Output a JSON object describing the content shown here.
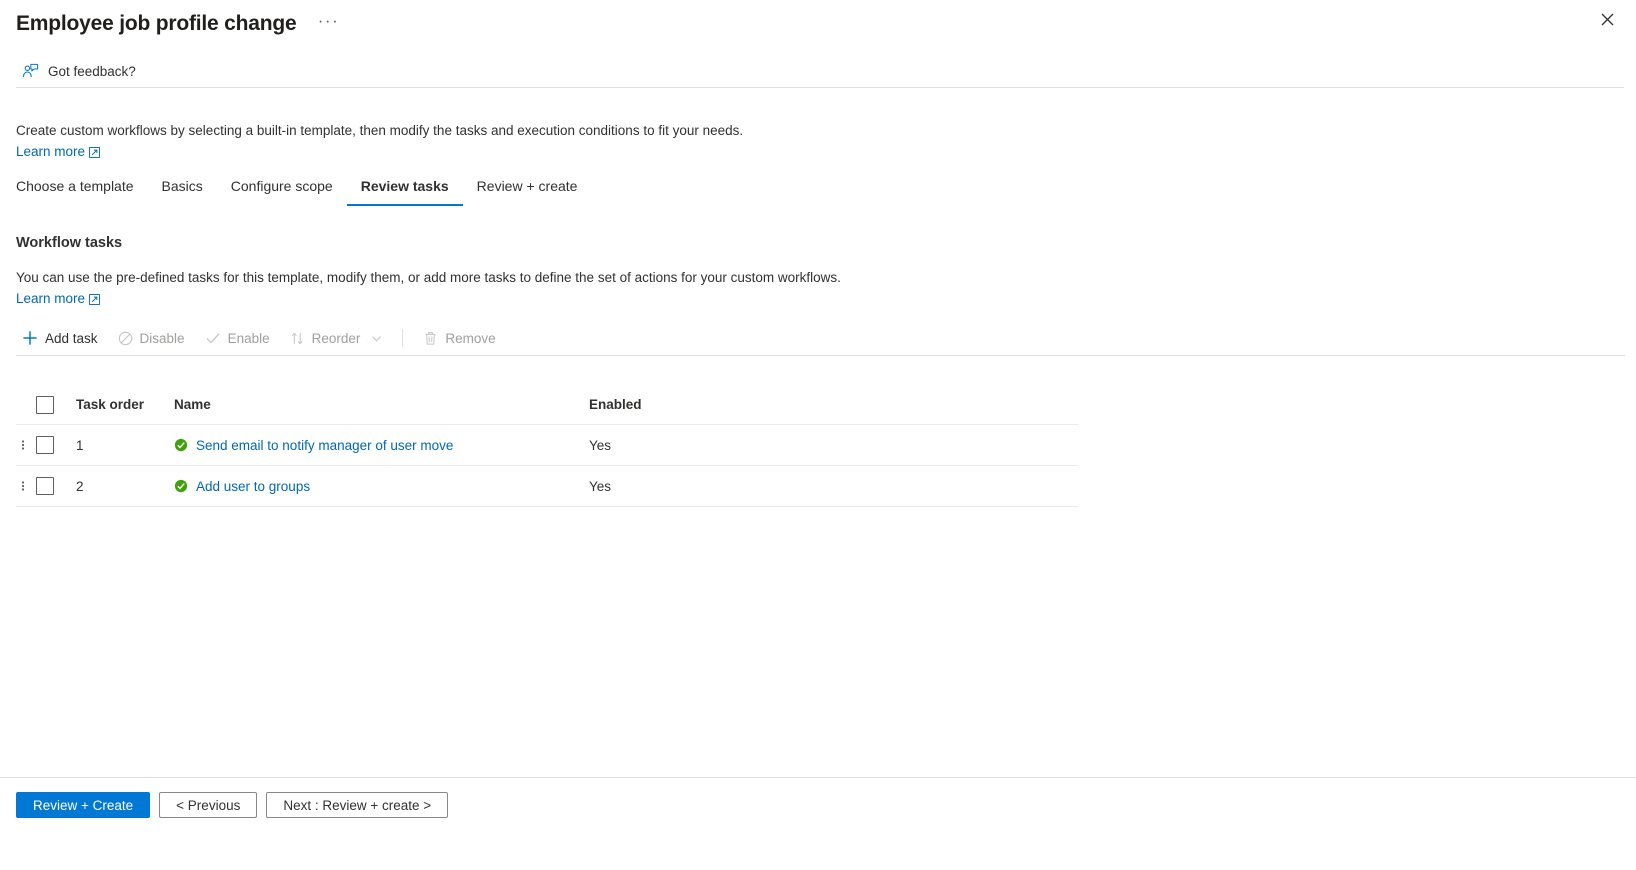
{
  "header": {
    "title": "Employee job profile change",
    "more_label": "···",
    "close_label": "✕"
  },
  "feedback": {
    "label": "Got feedback?"
  },
  "intro": {
    "text": "Create custom workflows by selecting a built-in template, then modify the tasks and execution conditions to fit your needs.",
    "learn_more": "Learn more"
  },
  "tabs": [
    {
      "label": "Choose a template",
      "active": false
    },
    {
      "label": "Basics",
      "active": false
    },
    {
      "label": "Configure scope",
      "active": false
    },
    {
      "label": "Review tasks",
      "active": true
    },
    {
      "label": "Review + create",
      "active": false
    }
  ],
  "section": {
    "title": "Workflow tasks",
    "description": "You can use the pre-defined tasks for this template, modify them, or add more tasks to define the set of actions for your custom workflows.",
    "learn_more": "Learn more"
  },
  "commandbar": [
    {
      "label": "Add task",
      "icon": "plus-icon",
      "disabled": false
    },
    {
      "label": "Disable",
      "icon": "block-icon",
      "disabled": true
    },
    {
      "label": "Enable",
      "icon": "checkmark-icon",
      "disabled": true
    },
    {
      "label": "Reorder",
      "icon": "sort-arrows-icon",
      "disabled": true,
      "chevron": true
    },
    {
      "label": "Remove",
      "icon": "trash-icon",
      "disabled": true
    }
  ],
  "table": {
    "columns": [
      "Task order",
      "Name",
      "Enabled"
    ],
    "rows": [
      {
        "order": "1",
        "name": "Send email to notify manager of user move",
        "enabled": "Yes"
      },
      {
        "order": "2",
        "name": "Add user to groups",
        "enabled": "Yes"
      }
    ]
  },
  "footer": {
    "primary": "Review + Create",
    "previous": "< Previous",
    "next": "Next : Review + create >"
  },
  "colors": {
    "accent": "#0078d4",
    "link": "#0067b8",
    "success": "#3fa20a",
    "disabled_text": "#a19f9d",
    "border": "#e1dfdd"
  }
}
